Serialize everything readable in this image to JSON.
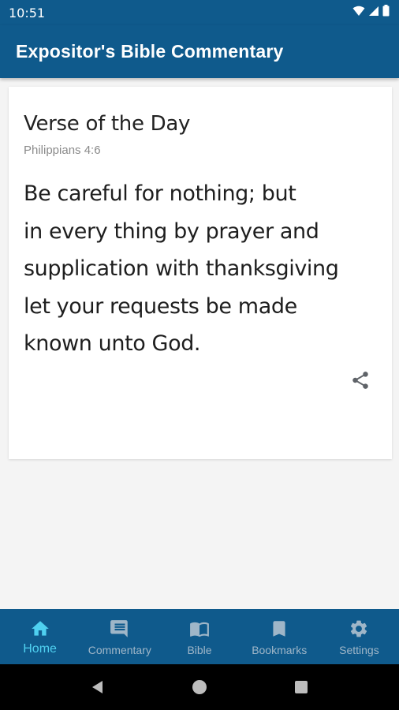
{
  "status_bar": {
    "time": "10:51",
    "icons": [
      "wifi-icon",
      "signal-icon",
      "battery-icon"
    ]
  },
  "app_bar": {
    "title": "Expositor's Bible Commentary"
  },
  "card": {
    "title": "Verse of the Day",
    "reference": "Philippians 4:6",
    "verse_lines": [
      "Be careful for nothing; but",
      "in every thing by prayer and",
      "supplication with thanksgiving",
      "let your requests be made",
      "known unto God."
    ],
    "share_icon": "share-icon"
  },
  "bottom_nav": {
    "items": [
      {
        "label": "Home",
        "icon": "home-icon",
        "active": true
      },
      {
        "label": "Commentary",
        "icon": "comment-icon",
        "active": false
      },
      {
        "label": "Bible",
        "icon": "book-icon",
        "active": false
      },
      {
        "label": "Bookmarks",
        "icon": "bookmark-icon",
        "active": false
      },
      {
        "label": "Settings",
        "icon": "gear-icon",
        "active": false
      }
    ]
  },
  "system_nav": {
    "buttons": [
      "back-icon",
      "home-circle-icon",
      "recents-icon"
    ]
  },
  "colors": {
    "primary": "#0f5a8c",
    "active_nav": "#4fd0f0",
    "inactive_nav": "#9fb6c8",
    "background": "#f4f4f4",
    "card": "#ffffff"
  }
}
